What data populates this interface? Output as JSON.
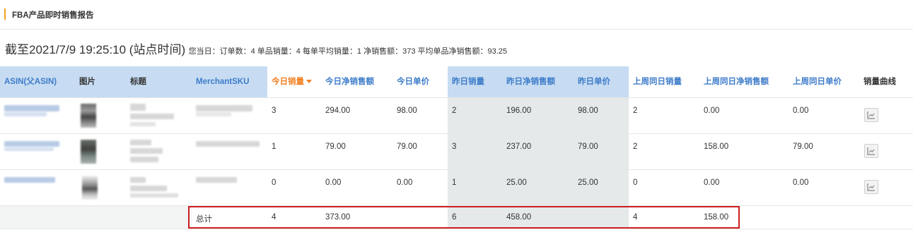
{
  "header": {
    "title": "FBA产品即时销售报告",
    "accent": "#f0a020"
  },
  "summary": {
    "as_of": "截至2021/7/9 19:25:10 (站点时间)",
    "stats": "您当日：订单数：4  单品销量：4  每单平均销量：1  净销售额：373  平均单品净销售额：93.25"
  },
  "table": {
    "columns": [
      "ASIN(父ASIN)",
      "图片",
      "标题",
      "MerchantSKU",
      "今日销量",
      "今日净销售额",
      "今日单价",
      "昨日销量",
      "昨日净销售额",
      "昨日单价",
      "上周同日销量",
      "上周同日净销售额",
      "上周同日单价",
      "销量曲线"
    ],
    "sort_column": "今日销量",
    "rows": [
      {
        "today_qty": "3",
        "today_sales": "294.00",
        "today_price": "98.00",
        "yest_qty": "2",
        "yest_sales": "196.00",
        "yest_price": "98.00",
        "lw_qty": "2",
        "lw_sales": "0.00",
        "lw_price": "0.00",
        "chart_icon": "line-chart-icon"
      },
      {
        "today_qty": "1",
        "today_sales": "79.00",
        "today_price": "79.00",
        "yest_qty": "3",
        "yest_sales": "237.00",
        "yest_price": "79.00",
        "lw_qty": "2",
        "lw_sales": "158.00",
        "lw_price": "79.00",
        "chart_icon": "line-chart-icon"
      },
      {
        "today_qty": "0",
        "today_sales": "0.00",
        "today_price": "0.00",
        "yest_qty": "1",
        "yest_sales": "25.00",
        "yest_price": "25.00",
        "lw_qty": "0",
        "lw_sales": "0.00",
        "lw_price": "0.00",
        "chart_icon": "line-chart-icon"
      }
    ],
    "total": {
      "label": "总计",
      "today_qty": "4",
      "today_sales": "373.00",
      "yest_qty": "6",
      "yest_sales": "458.00",
      "lw_qty": "4",
      "lw_sales": "158.00"
    }
  },
  "colors": {
    "header_blue": "#c7dcf2",
    "link_blue": "#3d7cc9",
    "sort_orange": "#f07f1f",
    "highlight_red": "#cc1f1f"
  }
}
